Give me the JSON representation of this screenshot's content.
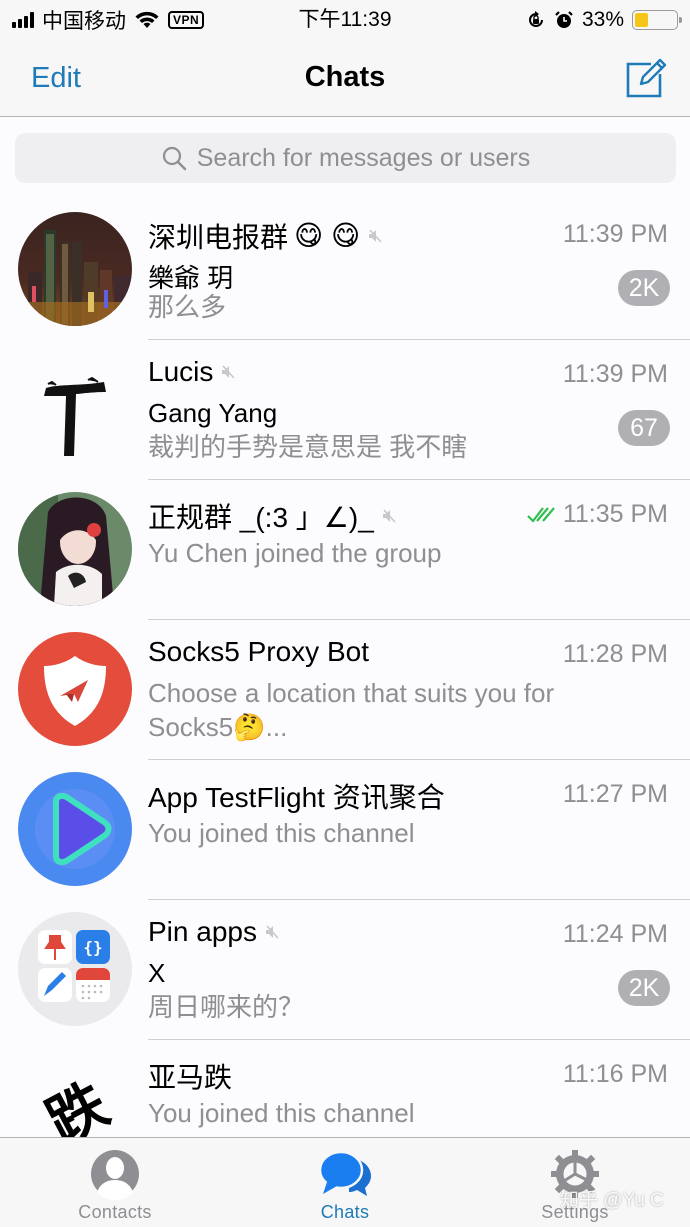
{
  "status_bar": {
    "carrier": "中国移动",
    "vpn_label": "VPN",
    "time": "下午11:39",
    "battery_percent_label": "33%",
    "battery_level": 0.33,
    "signal_bars": 4,
    "colors": {
      "battery_fill": "#f5c518"
    }
  },
  "nav": {
    "edit_label": "Edit",
    "title": "Chats",
    "compose_icon": "compose-icon",
    "accent_color": "#1f7bb8"
  },
  "search": {
    "placeholder": "Search for messages or users"
  },
  "chats": [
    {
      "name": "深圳电报群",
      "title_emojis": "😋 😋",
      "muted": true,
      "time": "11:39 PM",
      "sender": "樂爺 玥",
      "preview": "那么多",
      "unread": "2K",
      "avatar": "city-night-skyline"
    },
    {
      "name": "Lucis",
      "muted": true,
      "time": "11:39 PM",
      "sender": "Gang Yang",
      "preview": "裁判的手势是意思是 我不瞎",
      "unread": "67",
      "avatar": "letter-T-brush"
    },
    {
      "name": "正规群 _(:3 」∠)_",
      "muted": true,
      "time": "11:35 PM",
      "read_checks": true,
      "preview": "Yu Chen joined the group",
      "avatar": "anime-girl"
    },
    {
      "name": "Socks5 Proxy Bot",
      "muted": false,
      "time": "11:28 PM",
      "preview_line1": "Choose a location that suits you for",
      "preview_line2": "Socks5🤔...",
      "avatar": "shield-paper-plane"
    },
    {
      "name": "App TestFlight 资讯聚合",
      "muted": false,
      "time": "11:27 PM",
      "preview": "You joined this channel",
      "avatar": "play-triangle"
    },
    {
      "name": "Pin apps",
      "muted": true,
      "time": "11:24 PM",
      "sender": "X",
      "preview": "周日哪来的？",
      "unread": "2K",
      "avatar": "app-icons-grid"
    },
    {
      "name": "亚马跌",
      "muted": false,
      "time": "11:16 PM",
      "preview": "You joined this channel",
      "avatar": "character-跌",
      "avatar_glyph": "跌"
    }
  ],
  "tabs": [
    {
      "label": "Contacts",
      "icon": "contacts-icon",
      "active": false
    },
    {
      "label": "Chats",
      "icon": "chats-icon",
      "active": true
    },
    {
      "label": "Settings",
      "icon": "settings-icon",
      "active": false
    }
  ],
  "watermark": "知乎 @Yu C",
  "colors": {
    "badge": "#b0b0b4",
    "read_check": "#2fbf4f",
    "secondary_text": "#8e8e93"
  }
}
